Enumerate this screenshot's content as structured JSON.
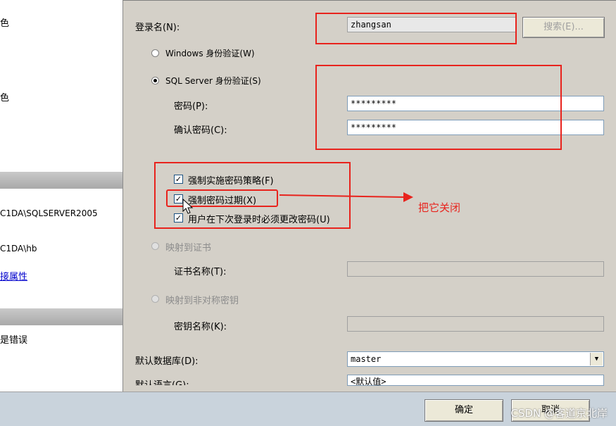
{
  "left": {
    "item_top": "色",
    "item_mid": "色",
    "server_path": "C1DA\\SQLSERVER2005",
    "user_path": "C1DA\\hb",
    "link": "接属性",
    "error_text": "是错误"
  },
  "form": {
    "login_label": "登录名(N):",
    "login_value": "zhangsan",
    "search_btn": "搜索(E)...",
    "windows_auth": "Windows 身份验证(W)",
    "sql_auth": "SQL Server 身份验证(S)",
    "password_label": "密码(P):",
    "password_value": "*********",
    "confirm_label": "确认密码(C):",
    "confirm_value": "*********",
    "enforce_policy": "强制实施密码策略(F)",
    "enforce_expiry": "强制密码过期(X)",
    "must_change": "用户在下次登录时必须更改密码(U)",
    "map_cert": "映射到证书",
    "cert_name_label": "证书名称(T):",
    "map_asym": "映射到非对称密钥",
    "key_name_label": "密钥名称(K):",
    "default_db_label": "默认数据库(D):",
    "default_db_value": "master",
    "default_lang_label": "默认语言(G):",
    "default_lang_value": "<默认值>"
  },
  "annotation": "把它关闭",
  "footer": {
    "ok": "确定",
    "cancel": "取消",
    "watermark": "CSDN @客道京北岸"
  },
  "colors": {
    "annotation_red": "#e8231d"
  }
}
